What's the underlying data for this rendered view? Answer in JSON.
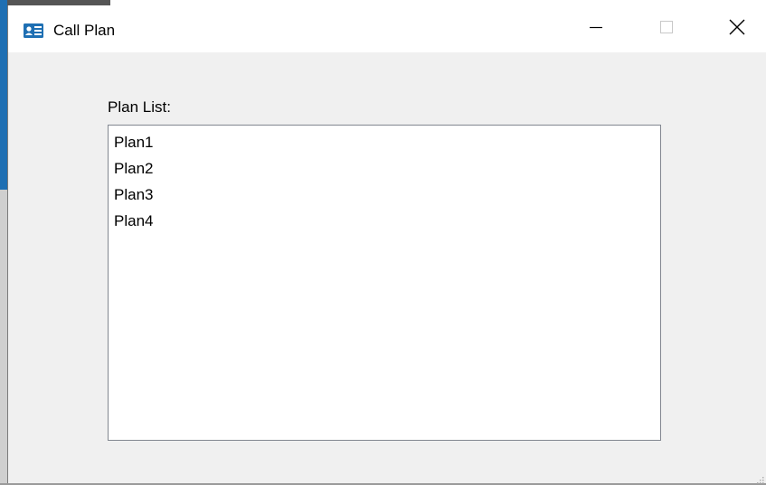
{
  "window": {
    "title": "Call Plan",
    "icon": "call-plan-app-icon",
    "controls": {
      "minimize_icon": "minimize-icon",
      "maximize_icon": "maximize-icon",
      "close_icon": "close-icon"
    }
  },
  "main": {
    "list_label": "Plan List:",
    "plans": [
      "Plan1",
      "Plan2",
      "Plan3",
      "Plan4"
    ]
  },
  "colors": {
    "title_bar": "#ffffff",
    "client_bg": "#f0f0f0",
    "listbox_border": "#828790",
    "icon_blue": "#1e6fb3"
  }
}
